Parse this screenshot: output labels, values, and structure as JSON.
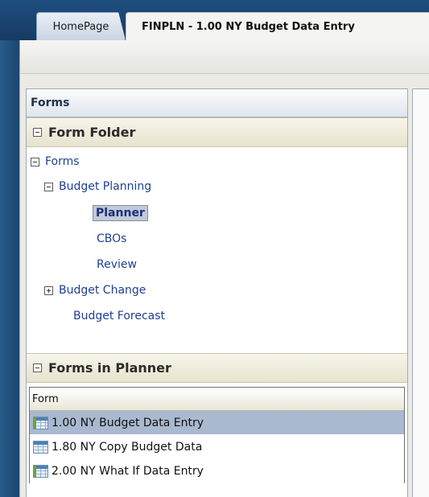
{
  "tabs": {
    "home_label": "HomePage",
    "active_label": "FINPLN - 1.00 NY Budget Data Entry"
  },
  "panel": {
    "title": "Forms"
  },
  "form_folder": {
    "header": "Form Folder",
    "tree": [
      {
        "label": "Forms",
        "expanded": true
      },
      {
        "label": "Budget Planning",
        "expanded": true
      },
      {
        "label": "Planner",
        "selected": true
      },
      {
        "label": "CBOs"
      },
      {
        "label": "Review"
      },
      {
        "label": "Budget Change",
        "expanded": false
      },
      {
        "label": "Budget Forecast"
      }
    ]
  },
  "forms_list": {
    "header": "Forms in Planner",
    "column_header": "Form",
    "rows": [
      {
        "label": "1.00 NY Budget Data Entry",
        "selected": true
      },
      {
        "label": "1.80 NY Copy Budget Data"
      },
      {
        "label": "2.00 NY What If Data Entry"
      }
    ]
  },
  "colors": {
    "tree_link": "#1f3f93",
    "selected_row": "#a9b9cf",
    "tab_strip": "#1f4e7f"
  }
}
